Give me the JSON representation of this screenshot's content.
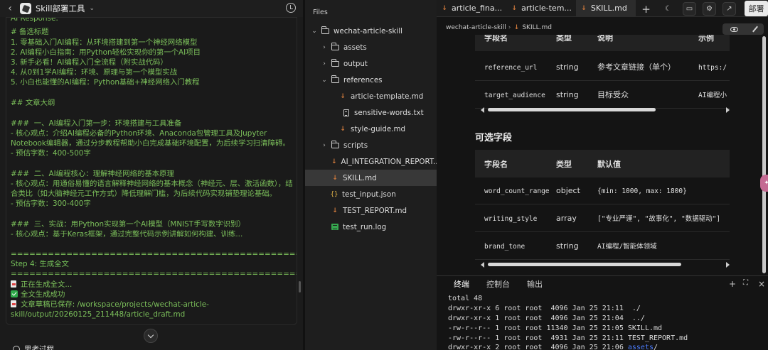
{
  "app": {
    "title": "Skill部署工具"
  },
  "chat": {
    "lines": [
      "AI Response:",
      "# 备选标题",
      "1. 零基础入门AI编程：从环境搭建到第一个神经网络模型",
      "2. AI编程小白指南：用Python轻松实现你的第一个AI项目",
      "3. 新手必看！AI编程入门全流程（附实战代码）",
      "4. 从0到1学AI编程：环境、原理与第一个模型实战",
      "5. 小白也能懂的AI编程：Python基础+神经网络入门教程",
      "## 文章大纲",
      "###  一、AI编程入门第一步：环境搭建与工具准备",
      "- 核心观点：介绍AI编程必备的Python环境、Anaconda包管理工具及Jupyter",
      "Notebook编辑器，通过分步教程帮助小白完成基础环境配置，为后续学习扫清障碍。",
      "- 预估字数：400-500字",
      "###  二、AI编程核心：理解神经网络的基本原理",
      "- 核心观点：用通俗易懂的语言解释神经网络的基本概念（神经元、层、激活函数），结",
      "合类比（如大脑神经元工作方式）降低理解门槛，为后续代码实现铺垫理论基础。",
      "- 预估字数：300-400字",
      "###  三、实战：用Python实现第一个AI模型（MNIST手写数字识别）",
      "- 核心观点：基于Keras框架，通过完整代码示例讲解如何构建、训练...",
      "====================================================",
      "Step 4: 生成全文",
      "====================================================",
      "正在生成全文...",
      "全文生成成功",
      "文章草稿已保存: /workspace/projects/wechat-article-",
      "skill/output/20260125_211448/article_draft.md"
    ]
  },
  "thinking": {
    "label": "思考过程"
  },
  "files": {
    "title": "Files",
    "root": "wechat-article-skill",
    "items": [
      {
        "name": "assets",
        "type": "folder"
      },
      {
        "name": "output",
        "type": "folder"
      },
      {
        "name": "references",
        "type": "folder-open"
      },
      {
        "name": "article-template.md",
        "type": "md"
      },
      {
        "name": "sensitive-words.txt",
        "type": "txt"
      },
      {
        "name": "style-guide.md",
        "type": "md"
      },
      {
        "name": "scripts",
        "type": "folder"
      },
      {
        "name": "AI_INTEGRATION_REPORT...",
        "type": "md"
      },
      {
        "name": "SKILL.md",
        "type": "md"
      },
      {
        "name": "test_input.json",
        "type": "json"
      },
      {
        "name": "TEST_REPORT.md",
        "type": "md"
      },
      {
        "name": "test_run.log",
        "type": "log"
      }
    ]
  },
  "tabs": [
    "article_fina...",
    "article-tem...",
    "SKILL.md"
  ],
  "toolbar": {
    "deploy_label": "部署"
  },
  "crumb": {
    "folder": "wechat-article-skill",
    "file": "SKILL.md"
  },
  "preview": {
    "table1": {
      "headers": [
        "字段名",
        "类型",
        "说明",
        "示例"
      ],
      "rows": [
        [
          "reference_url",
          "string",
          "参考文章链接（单个）",
          "https:/"
        ],
        [
          "target_audience",
          "string",
          "目标受众",
          "AI编程小"
        ]
      ]
    },
    "optional_title": "可选字段",
    "table2": {
      "headers": [
        "字段名",
        "类型",
        "默认值"
      ],
      "rows": [
        [
          "word_count_range",
          "object",
          "{min: 1000, max: 1800}"
        ],
        [
          "writing_style",
          "array",
          "[\"专业严谨\", \"故事化\", \"数据驱动\"]"
        ],
        [
          "brand_tone",
          "string",
          "AI编程/智能体领域"
        ]
      ]
    }
  },
  "terminal": {
    "tabs": [
      "终端",
      "控制台",
      "输出"
    ],
    "lines": [
      "total 48",
      "drwxr-xr-x 6 root root  4096 Jan 25 21:11  ./",
      "drwxr-xr-x 1 root root  4096 Jan 25 21:04  ../",
      "-rw-r--r-- 1 root root 11340 Jan 25 21:05 SKILL.md",
      "-rw-r--r-- 1 root root  4931 Jan 25 21:11 TEST_REPORT.md",
      "drwxr-xr-x 2 root root  4096 Jan 25 21:06 "
    ],
    "last_dir": "assets",
    "last_dir_suffix": "/"
  }
}
